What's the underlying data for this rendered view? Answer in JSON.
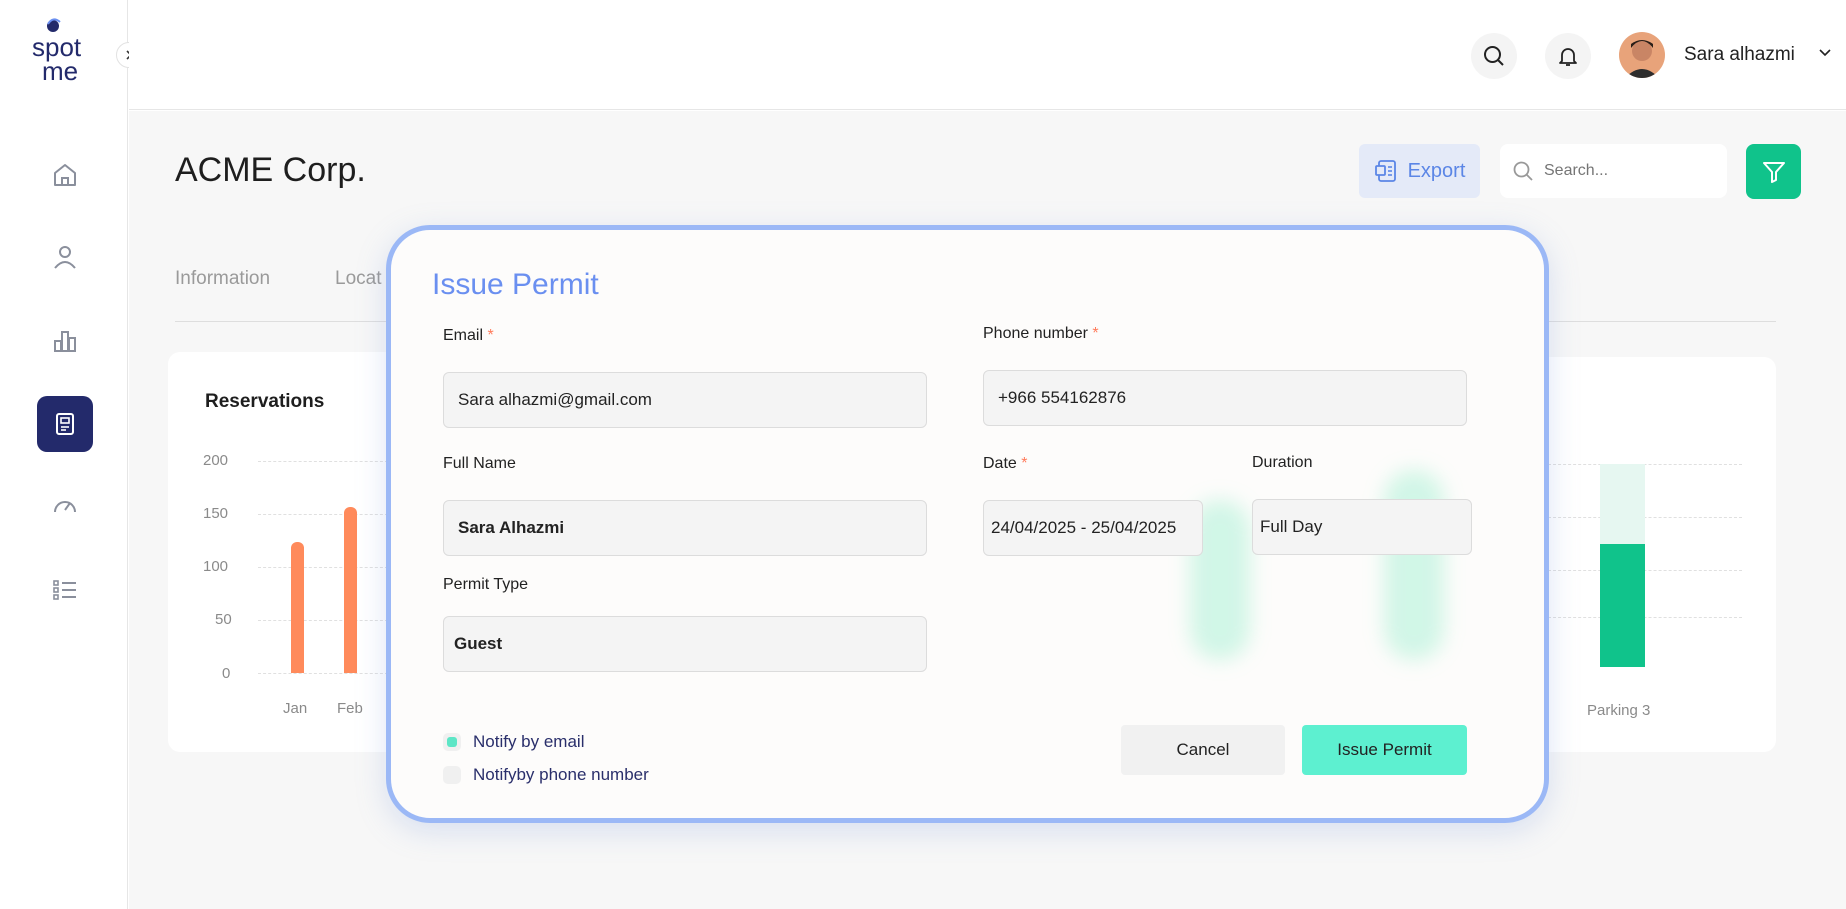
{
  "app": {
    "logo_text_top": "spot",
    "logo_text_bottom": "me"
  },
  "user": {
    "name": "Sara alhazmi"
  },
  "page": {
    "title": "ACME Corp."
  },
  "toolbar": {
    "export_label": "Export",
    "search_placeholder": "Search..."
  },
  "tabs": [
    {
      "label": "Information"
    },
    {
      "label": "Locat"
    }
  ],
  "chart": {
    "title": "Reservations",
    "y_ticks": [
      "200",
      "150",
      "100",
      "50",
      "0"
    ],
    "x_ticks": [
      "Jan",
      "Feb"
    ],
    "right_x_tick": "Parking 3"
  },
  "chart_data": {
    "type": "bar",
    "title": "Reservations",
    "categories": [
      "Jan",
      "Feb"
    ],
    "values": [
      124,
      157
    ],
    "ylim": [
      0,
      200
    ]
  },
  "modal": {
    "title": "Issue Permit",
    "email_label": "Email",
    "email_value": "Sara alhazmi@gmail.com",
    "phone_label": "Phone number",
    "phone_value": "+966 554162876",
    "fullname_label": "Full Name",
    "fullname_value": "Sara Alhazmi",
    "date_label": "Date",
    "date_value": "24/04/2025 - 25/04/2025",
    "duration_label": "Duration",
    "duration_value": "Full Day",
    "permit_type_label": "Permit Type",
    "permit_type_value": "Guest",
    "required_mark": "*",
    "notify_email_label": "Notify by email",
    "notify_phone_label": "Notifyby phone number",
    "cancel_label": "Cancel",
    "issue_label": "Issue Permit"
  },
  "colors": {
    "accent": "#10c38b",
    "brand": "#232a6b",
    "modal_title": "#6a8ff0",
    "bar": "#ff8a5b"
  }
}
